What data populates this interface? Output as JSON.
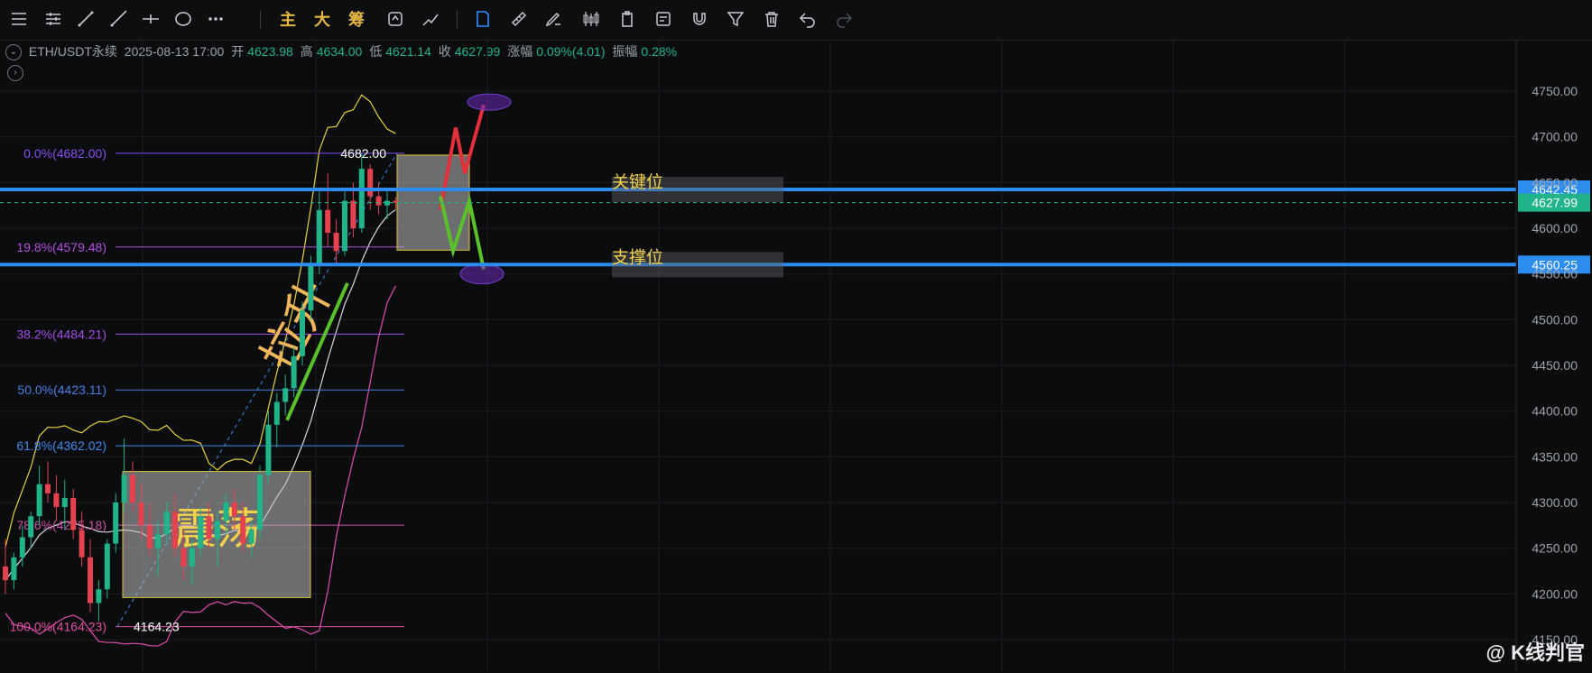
{
  "toolbar": {
    "tools": [
      "menu-icon",
      "bars-icon",
      "trendline-icon",
      "ray-icon",
      "crosshair-line-icon",
      "circle-icon",
      "more-dots-icon"
    ],
    "main_label": "主",
    "big_label": "大",
    "chip_label": "筹",
    "tools_right": [
      "sync-icon",
      "measure-icon",
      "pin-icon",
      "ruler-icon",
      "brush-icon",
      "candles-icon",
      "clipboard-icon",
      "note-icon",
      "magnet-icon",
      "filter-icon",
      "trash-icon",
      "undo-icon",
      "redo-icon"
    ]
  },
  "info": {
    "symbol": "ETH/USDT永续",
    "datetime": "2025-08-13 17:00",
    "open_label": "开",
    "open": "4623.98",
    "high_label": "高",
    "high": "4634.00",
    "low_label": "低",
    "low": "4621.14",
    "close_label": "收",
    "close": "4627.99",
    "change_label": "涨幅",
    "change": "0.09%(4.01)",
    "amplitude_label": "振幅",
    "amplitude": "0.28%"
  },
  "chart_data": {
    "type": "candlestick",
    "y_ticks": [
      "4750.00",
      "4700.00",
      "4650.00",
      "4600.00",
      "4550.00",
      "4500.00",
      "4450.00",
      "4400.00",
      "4350.00",
      "4300.00",
      "4250.00",
      "4200.00",
      "4150.00"
    ],
    "ylim": [
      4140,
      4770
    ],
    "fib_levels": [
      {
        "label": "0.0%(4682.00)",
        "value": 4682.0,
        "color": "#8a4df2"
      },
      {
        "label": "19.8%(4579.48)",
        "value": 4579.48,
        "color": "#b54fe0"
      },
      {
        "label": "38.2%(4484.21)",
        "value": 4484.21,
        "color": "#a34ee6"
      },
      {
        "label": "50.0%(4423.11)",
        "value": 4423.11,
        "color": "#4a7de3"
      },
      {
        "label": "61.8%(4362.02)",
        "value": 4362.02,
        "color": "#3e8ae8"
      },
      {
        "label": "78.6%(4275.18)",
        "value": 4275.18,
        "color": "#d04fa8"
      },
      {
        "label": "100.0%(4164.23)",
        "value": 4164.23,
        "color": "#e34fa1"
      }
    ],
    "high_marker": "4682.00",
    "low_marker": "4164.23",
    "key_level": {
      "label": "关键位",
      "value": 4642.45,
      "tag": "4642.45"
    },
    "support_level": {
      "label": "支撑位",
      "value": 4560.25,
      "tag": "4560.25"
    },
    "current_price": {
      "value": 4627.99,
      "tag": "4627.99"
    },
    "range_box_label": "震荡",
    "trend_label": "拉升",
    "candles": [
      [
        4230,
        4260,
        4200,
        4215
      ],
      [
        4215,
        4245,
        4205,
        4240
      ],
      [
        4240,
        4275,
        4230,
        4262
      ],
      [
        4262,
        4290,
        4250,
        4285
      ],
      [
        4285,
        4340,
        4275,
        4320
      ],
      [
        4320,
        4345,
        4300,
        4310
      ],
      [
        4310,
        4330,
        4280,
        4295
      ],
      [
        4295,
        4325,
        4270,
        4305
      ],
      [
        4305,
        4315,
        4260,
        4270
      ],
      [
        4270,
        4290,
        4230,
        4240
      ],
      [
        4240,
        4260,
        4180,
        4190
      ],
      [
        4190,
        4215,
        4170,
        4205
      ],
      [
        4205,
        4260,
        4195,
        4255
      ],
      [
        4255,
        4310,
        4245,
        4300
      ],
      [
        4300,
        4370,
        4290,
        4330
      ],
      [
        4330,
        4345,
        4290,
        4300
      ],
      [
        4300,
        4320,
        4260,
        4275
      ],
      [
        4275,
        4300,
        4240,
        4250
      ],
      [
        4250,
        4280,
        4220,
        4265
      ],
      [
        4265,
        4300,
        4255,
        4290
      ],
      [
        4290,
        4310,
        4240,
        4250
      ],
      [
        4250,
        4270,
        4215,
        4230
      ],
      [
        4230,
        4260,
        4210,
        4250
      ],
      [
        4250,
        4295,
        4240,
        4285
      ],
      [
        4285,
        4300,
        4250,
        4260
      ],
      [
        4260,
        4290,
        4230,
        4280
      ],
      [
        4280,
        4310,
        4265,
        4300
      ],
      [
        4300,
        4315,
        4270,
        4285
      ],
      [
        4285,
        4300,
        4245,
        4255
      ],
      [
        4255,
        4280,
        4240,
        4270
      ],
      [
        4270,
        4340,
        4260,
        4330
      ],
      [
        4330,
        4400,
        4320,
        4385
      ],
      [
        4385,
        4420,
        4360,
        4410
      ],
      [
        4410,
        4440,
        4395,
        4425
      ],
      [
        4425,
        4470,
        4415,
        4460
      ],
      [
        4460,
        4520,
        4450,
        4510
      ],
      [
        4510,
        4570,
        4500,
        4560
      ],
      [
        4560,
        4640,
        4550,
        4620
      ],
      [
        4620,
        4660,
        4580,
        4595
      ],
      [
        4595,
        4610,
        4560,
        4575
      ],
      [
        4575,
        4640,
        4570,
        4630
      ],
      [
        4630,
        4650,
        4590,
        4600
      ],
      [
        4600,
        4682,
        4595,
        4665
      ],
      [
        4665,
        4670,
        4620,
        4635
      ],
      [
        4635,
        4650,
        4615,
        4625
      ],
      [
        4625,
        4640,
        4610,
        4630
      ],
      [
        4630,
        4634,
        4621,
        4628
      ]
    ]
  },
  "watermark": "@ K线判官"
}
